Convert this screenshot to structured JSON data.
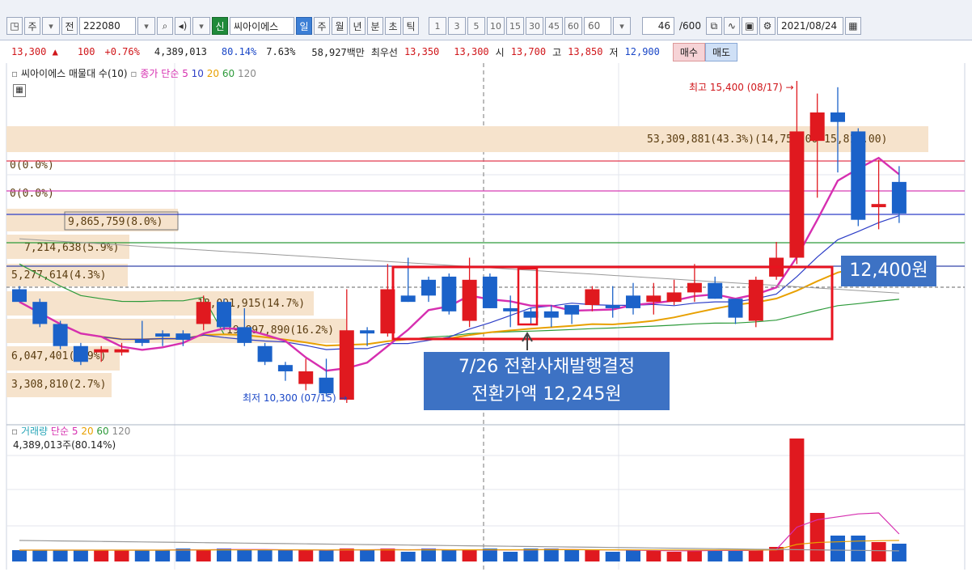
{
  "toolbar": {
    "code": "222080",
    "name": "씨아이에스",
    "period_buttons": [
      "일",
      "주",
      "월",
      "년",
      "분",
      "초",
      "틱"
    ],
    "num_buttons": [
      "1",
      "3",
      "5",
      "10",
      "15",
      "30",
      "45",
      "60"
    ],
    "count_value": "60",
    "page_count": "46",
    "page_total": "/600",
    "date": "2021/08/24",
    "left_buttons": [
      "주",
      "전"
    ]
  },
  "quote": {
    "price": "13,300",
    "change": "100",
    "change_pct": "+0.76%",
    "volume": "4,389,013",
    "vol_ratio": "80.14%",
    "turnover": "7.63%",
    "amount": "58,927백만",
    "best_label": "최우선",
    "ask": "13,350",
    "bid": "13,300",
    "open_label": "시",
    "open": "13,700",
    "high_label": "고",
    "high": "13,850",
    "low_label": "저",
    "low": "12,900",
    "buy_label": "매수",
    "sell_label": "매도"
  },
  "price_legend": {
    "title": "씨아이에스 매물대 수(10)",
    "ma_label": "종가 단순",
    "ma_periods": [
      "5",
      "10",
      "20",
      "60",
      "120"
    ]
  },
  "volume_legend": {
    "title": "거래량",
    "ma_label": "단순",
    "ma_periods": [
      "5",
      "20",
      "60",
      "120"
    ],
    "value": "4,389,013주(80.14%)"
  },
  "annotations": {
    "high": "최고 15,400 (08/17) →",
    "low": "최저 10,300 (07/15) →",
    "event_line1": "7/26 전환사채발행결정",
    "event_line2": "전환가액 12,245원",
    "price_box": "12,400원"
  },
  "volume_profile": [
    {
      "label": "53,309,881(43.3%)(14,750.00~15,815.00)"
    },
    {
      "label": "0(0.0%)"
    },
    {
      "label": "0(0.0%)"
    },
    {
      "label": "9,865,759(8.0%)"
    },
    {
      "label": "7,214,638(5.9%)"
    },
    {
      "label": "5,277,614(4.3%)"
    },
    {
      "label": "18,091,915(14.7%)"
    },
    {
      "label": "19,897,890(16.2%)"
    },
    {
      "label": "6,047,401(4.9%)"
    },
    {
      "label": "3,308,810(2.7%)"
    }
  ],
  "chart_data": {
    "type": "candlestick",
    "note_units": "KRW",
    "candles": [
      {
        "o": 12100,
        "h": 12150,
        "l": 11900,
        "c": 11900
      },
      {
        "o": 11900,
        "h": 11950,
        "l": 11500,
        "c": 11550
      },
      {
        "o": 11550,
        "h": 11600,
        "l": 11150,
        "c": 11200
      },
      {
        "o": 11200,
        "h": 11250,
        "l": 10900,
        "c": 10950
      },
      {
        "o": 11100,
        "h": 11200,
        "l": 10950,
        "c": 11150
      },
      {
        "o": 11150,
        "h": 11250,
        "l": 11050,
        "c": 11100
      },
      {
        "o": 11250,
        "h": 11600,
        "l": 11200,
        "c": 11300
      },
      {
        "o": 11350,
        "h": 11450,
        "l": 11200,
        "c": 11400
      },
      {
        "o": 11400,
        "h": 11450,
        "l": 11200,
        "c": 11300
      },
      {
        "o": 11550,
        "h": 12000,
        "l": 11450,
        "c": 11900
      },
      {
        "o": 11900,
        "h": 11950,
        "l": 11450,
        "c": 11500
      },
      {
        "o": 11500,
        "h": 11800,
        "l": 11200,
        "c": 11250
      },
      {
        "o": 11200,
        "h": 11250,
        "l": 10900,
        "c": 10950
      },
      {
        "o": 10900,
        "h": 10950,
        "l": 10650,
        "c": 10800
      },
      {
        "o": 10800,
        "h": 11000,
        "l": 10500,
        "c": 10600
      },
      {
        "o": 10700,
        "h": 11000,
        "l": 10400,
        "c": 10450
      },
      {
        "o": 10350,
        "h": 12100,
        "l": 10300,
        "c": 11450
      },
      {
        "o": 11450,
        "h": 11500,
        "l": 11200,
        "c": 11400
      },
      {
        "o": 11400,
        "h": 12500,
        "l": 11350,
        "c": 12100
      },
      {
        "o": 12000,
        "h": 12600,
        "l": 11900,
        "c": 11900
      },
      {
        "o": 12250,
        "h": 12300,
        "l": 11900,
        "c": 12000
      },
      {
        "o": 12300,
        "h": 12350,
        "l": 11700,
        "c": 11750
      },
      {
        "o": 11600,
        "h": 12600,
        "l": 11500,
        "c": 12250
      },
      {
        "o": 12300,
        "h": 12350,
        "l": 11800,
        "c": 11800
      },
      {
        "o": 11800,
        "h": 12000,
        "l": 11500,
        "c": 11750
      },
      {
        "o": 11750,
        "h": 11800,
        "l": 11550,
        "c": 11650
      },
      {
        "o": 11650,
        "h": 11850,
        "l": 11500,
        "c": 11750
      },
      {
        "o": 11700,
        "h": 11800,
        "l": 11550,
        "c": 11850
      },
      {
        "o": 12100,
        "h": 12150,
        "l": 11750,
        "c": 11850
      },
      {
        "o": 11850,
        "h": 12150,
        "l": 11650,
        "c": 11800
      },
      {
        "o": 11800,
        "h": 12200,
        "l": 11700,
        "c": 12000
      },
      {
        "o": 12000,
        "h": 12200,
        "l": 11700,
        "c": 11900
      },
      {
        "o": 11900,
        "h": 12250,
        "l": 11850,
        "c": 12050
      },
      {
        "o": 12050,
        "h": 12500,
        "l": 11900,
        "c": 12200
      },
      {
        "o": 12200,
        "h": 12300,
        "l": 11950,
        "c": 11950
      },
      {
        "o": 11950,
        "h": 11950,
        "l": 11550,
        "c": 11650
      },
      {
        "o": 11600,
        "h": 12300,
        "l": 11500,
        "c": 12250
      },
      {
        "o": 12300,
        "h": 12850,
        "l": 12250,
        "c": 12600
      },
      {
        "o": 12600,
        "h": 15400,
        "l": 12500,
        "c": 14600
      },
      {
        "o": 14450,
        "h": 15200,
        "l": 13550,
        "c": 14900
      },
      {
        "o": 14900,
        "h": 15300,
        "l": 13950,
        "c": 14750
      },
      {
        "o": 14600,
        "h": 14650,
        "l": 13100,
        "c": 13200
      },
      {
        "o": 13400,
        "h": 14150,
        "l": 13050,
        "c": 13450
      },
      {
        "o": 13800,
        "h": 14050,
        "l": 13150,
        "c": 13300
      }
    ],
    "candle_colors": [
      "down",
      "down",
      "down",
      "down",
      "up",
      "up",
      "down",
      "down",
      "down",
      "up",
      "down",
      "down",
      "down",
      "down",
      "up",
      "down",
      "up",
      "down",
      "up",
      "down",
      "down",
      "down",
      "up",
      "down",
      "down",
      "down",
      "down",
      "down",
      "up",
      "down",
      "down",
      "up",
      "up",
      "up",
      "down",
      "down",
      "up",
      "up",
      "up",
      "up",
      "down",
      "down",
      "up",
      "down"
    ],
    "volume": [
      14,
      14,
      14,
      14,
      14,
      14,
      14,
      14,
      16,
      14,
      16,
      14,
      14,
      14,
      14,
      14,
      16,
      14,
      16,
      12,
      16,
      14,
      14,
      16,
      12,
      16,
      16,
      14,
      14,
      12,
      14,
      14,
      12,
      14,
      14,
      14,
      14,
      18,
      152,
      60,
      32,
      32,
      24,
      22
    ],
    "volume_scale_max": 160,
    "high_annotation": 15400,
    "low_annotation": 10300,
    "price_box_level": 12400
  }
}
